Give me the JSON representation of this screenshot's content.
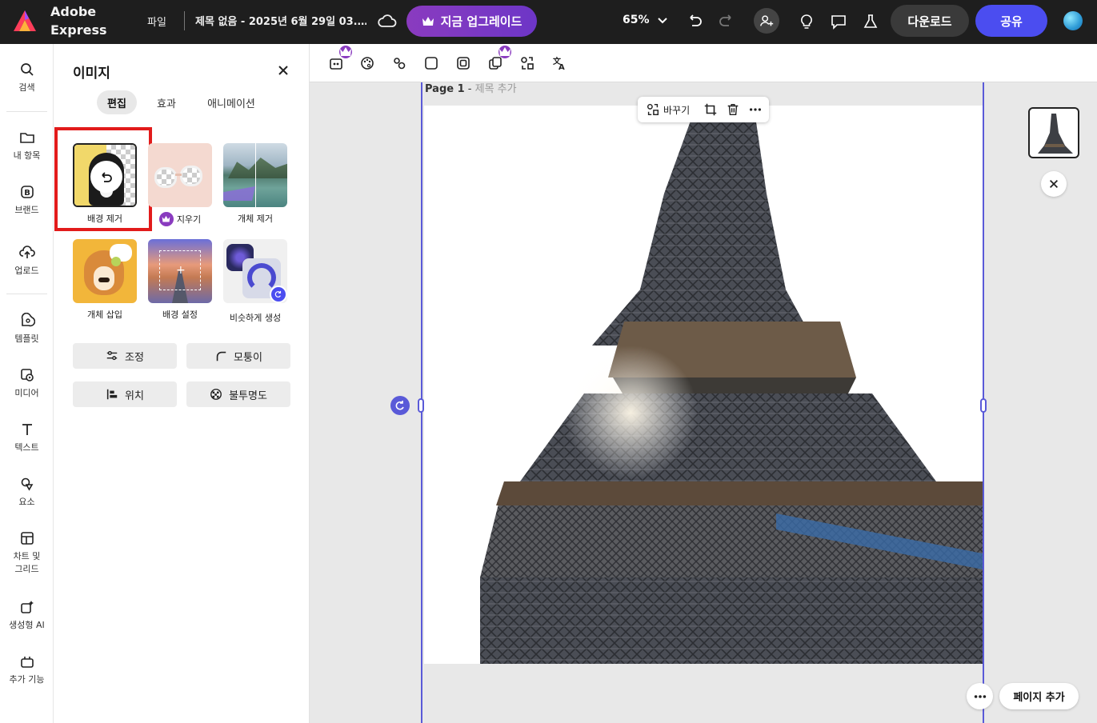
{
  "app": {
    "brand_line1": "Adobe",
    "brand_line2": "Express",
    "file_menu": "파일",
    "doc_title": "제목 없음 - 2025년 6월 29일 03.…",
    "upgrade_label": "지금 업그레이드",
    "zoom": "65%",
    "download_label": "다운로드",
    "share_label": "공유",
    "accent_color": "#4b4df0",
    "upgrade_color": "#8a3bbf"
  },
  "rail": {
    "items": [
      {
        "label": "검색",
        "icon": "search-icon"
      },
      {
        "label": "내 항목",
        "icon": "folder-icon"
      },
      {
        "label": "브랜드",
        "icon": "brand-icon"
      },
      {
        "label": "업로드",
        "icon": "upload-icon"
      },
      {
        "label": "템플릿",
        "icon": "template-icon"
      },
      {
        "label": "미디어",
        "icon": "media-icon"
      },
      {
        "label": "텍스트",
        "icon": "text-icon"
      },
      {
        "label": "요소",
        "icon": "elements-icon"
      },
      {
        "label": "차트 및",
        "label2": "그리드",
        "icon": "grid-icon"
      },
      {
        "label": "생성형 AI",
        "icon": "ai-icon"
      },
      {
        "label": "추가 기능",
        "icon": "addons-icon"
      }
    ]
  },
  "panel": {
    "title": "이미지",
    "tabs": [
      "편집",
      "효과",
      "애니메이션"
    ],
    "active_tab": "편집",
    "tools": [
      {
        "label": "배경 제거",
        "premium": false
      },
      {
        "label": "지우기",
        "premium": true
      },
      {
        "label": "개체 제거",
        "premium": false
      },
      {
        "label": "개체 삽입",
        "premium": false
      },
      {
        "label": "배경 설정",
        "premium": false
      },
      {
        "label": "비슷하게 생성",
        "premium": false
      }
    ],
    "buttons": [
      "조정",
      "모퉁이",
      "위치",
      "불투명도"
    ]
  },
  "canvas": {
    "page_prefix": "Page 1",
    "page_sep": " - ",
    "page_title_placeholder": "제목 추가",
    "float_replace": "바꾸기",
    "add_page": "페이지 추가"
  }
}
